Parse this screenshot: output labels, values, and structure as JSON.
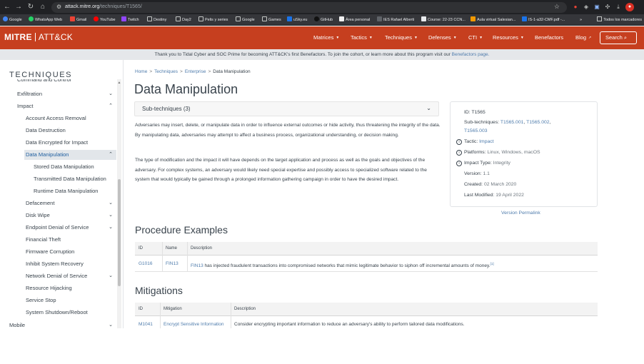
{
  "browser": {
    "url_host": "attack.mitre.org",
    "url_path": "/techniques/T1565/",
    "bookmarks": [
      "Google",
      "WhatsApp Web",
      "Gmail",
      "YouTube",
      "Twitch",
      "Destiny",
      "Day2",
      "Pelis y series",
      "Google",
      "Games",
      "uSky.eu",
      "GitHub",
      "Área personal",
      "IES Rafael Alberti",
      "Course: 22-23 CCN...",
      "Aula virtual Salesian...",
      "IS-1-a32-CMF.pdf -..."
    ],
    "bookmarks_more": "»",
    "other_bookmarks": "Todos los marcadores"
  },
  "header": {
    "logo_mitre": "MITRE",
    "logo_attck": "ATT&CK",
    "nav": [
      "Matrices",
      "Tactics",
      "Techniques",
      "Defenses",
      "CTI",
      "Resources",
      "Benefactors",
      "Blog"
    ],
    "search_label": "Search"
  },
  "banner": {
    "text_prefix": "Thank you to Tidal Cyber and SOC Prime for becoming ATT&CK's first Benefactors. To join the cohort, or learn more about this program visit our",
    "link": "Benefactors page.",
    "text_suffix": ""
  },
  "sidebar": {
    "title": "TECHNIQUES",
    "items": [
      {
        "label": "Command and Control",
        "caret": ""
      },
      {
        "label": "Exfiltration",
        "caret": "⌄"
      },
      {
        "label": "Impact",
        "caret": "⌃"
      },
      {
        "label": "Account Access Removal",
        "caret": ""
      },
      {
        "label": "Data Destruction",
        "caret": ""
      },
      {
        "label": "Data Encrypted for Impact",
        "caret": ""
      },
      {
        "label": "Data Manipulation",
        "caret": "⌃"
      },
      {
        "label": "Stored Data Manipulation",
        "caret": ""
      },
      {
        "label": "Transmitted Data Manipulation",
        "caret": ""
      },
      {
        "label": "Runtime Data Manipulation",
        "caret": ""
      },
      {
        "label": "Defacement",
        "caret": "⌄"
      },
      {
        "label": "Disk Wipe",
        "caret": "⌄"
      },
      {
        "label": "Endpoint Denial of Service",
        "caret": "⌄"
      },
      {
        "label": "Financial Theft",
        "caret": ""
      },
      {
        "label": "Firmware Corruption",
        "caret": ""
      },
      {
        "label": "Inhibit System Recovery",
        "caret": ""
      },
      {
        "label": "Network Denial of Service",
        "caret": "⌄"
      },
      {
        "label": "Resource Hijacking",
        "caret": ""
      },
      {
        "label": "Service Stop",
        "caret": ""
      },
      {
        "label": "System Shutdown/Reboot",
        "caret": ""
      },
      {
        "label": "Mobile",
        "caret": "⌄"
      }
    ]
  },
  "breadcrumb": [
    "Home",
    "Techniques",
    "Enterprise",
    "Data Manipulation"
  ],
  "page_title": "Data Manipulation",
  "subtechniques_label": "Sub-techniques (3)",
  "description": [
    "Adversaries may insert, delete, or manipulate data in order to influence external outcomes or hide activity, thus threatening the integrity of the data. By manipulating data, adversaries may attempt to affect a business process, organizational understanding, or decision making.",
    "The type of modification and the impact it will have depends on the target application and process as well as the goals and objectives of the adversary. For complex systems, an adversary would likely need special expertise and possibly access to specialized software related to the system that would typically be gained through a prolonged information gathering campaign in order to have the desired impact."
  ],
  "card": {
    "id": "ID: T1565",
    "subtech_label": "Sub-techniques:",
    "subtech_1": "T1565.001",
    "subtech_2": "T1565.002",
    "subtech_3": "T1565.003",
    "tactic_label": "Tactic:",
    "tactic": "Impact",
    "platforms_label": "Platforms:",
    "platforms": "Linux, Windows, macOS",
    "impact_label": "Impact Type:",
    "impact": "Integrity",
    "version_label": "Version:",
    "version": "1.1",
    "created_label": "Created:",
    "created": "02 March 2020",
    "modified_label": "Last Modified:",
    "modified": "19 April 2022",
    "permalink": "Version Permalink"
  },
  "procedures": {
    "title": "Procedure Examples",
    "headers": [
      "ID",
      "Name",
      "Description"
    ],
    "rows": [
      {
        "id": "G1016",
        "name": "FIN13",
        "desc_link": "FIN13",
        "desc": " has injected fraudulent transactions into compromised networks that mimic legitimate behavior to siphon off incremental amounts of money.",
        "ref": "[1]"
      }
    ]
  },
  "mitigations": {
    "title": "Mitigations",
    "headers": [
      "ID",
      "Mitigation",
      "Description"
    ],
    "rows": [
      {
        "id": "M1041",
        "name": "Encrypt Sensitive Information",
        "desc": "Consider encrypting important information to reduce an adversary's ability to perform tailored data modifications."
      }
    ]
  }
}
